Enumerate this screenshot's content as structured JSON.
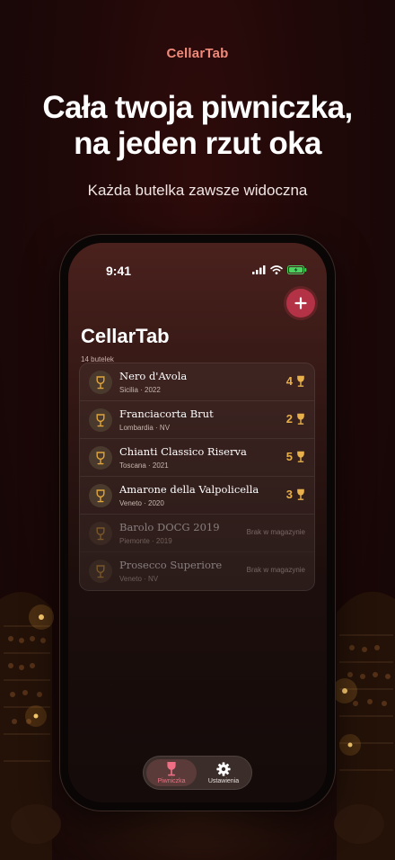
{
  "brand": "CellarTab",
  "headline": {
    "line1": "Cała twoja piwniczka,",
    "line2": "na jeden rzut oka"
  },
  "subhead": "Każda butelka zawsze widoczna",
  "status_bar": {
    "time": "9:41",
    "icons": [
      "signal-icon",
      "wifi-icon",
      "battery-charging-icon"
    ]
  },
  "app": {
    "title": "CellarTab",
    "bottle_count": "14 butelek",
    "add_button_icon": "plus-icon",
    "wines": [
      {
        "name": "Nero d'Avola",
        "meta": "Sicilia · 2022",
        "quantity": "4",
        "status": "in_stock"
      },
      {
        "name": "Franciacorta Brut",
        "meta": "Lombardia · NV",
        "quantity": "2",
        "status": "in_stock"
      },
      {
        "name": "Chianti Classico Riserva",
        "meta": "Toscana · 2021",
        "quantity": "5",
        "status": "in_stock"
      },
      {
        "name": "Amarone della Valpolicella",
        "meta": "Veneto · 2020",
        "quantity": "3",
        "status": "in_stock"
      },
      {
        "name": "Barolo DOCG 2019",
        "meta": "Piemonte · 2019",
        "quantity": "",
        "status": "out",
        "status_label": "Brak w magazynie"
      },
      {
        "name": "Prosecco Superiore",
        "meta": "Veneto · NV",
        "quantity": "",
        "status": "out",
        "status_label": "Brak w magazynie"
      }
    ]
  },
  "tabbar": {
    "tabs": [
      {
        "label": "Piwniczka",
        "icon": "wine-glass-icon",
        "active": true
      },
      {
        "label": "Ustawienia",
        "icon": "gear-icon",
        "active": false
      }
    ]
  },
  "colors": {
    "brand": "#f08a7a",
    "accent": "#b43245",
    "quantity": "#e8b04a",
    "active_tab": "#f06e83",
    "background": "#1f0808"
  }
}
